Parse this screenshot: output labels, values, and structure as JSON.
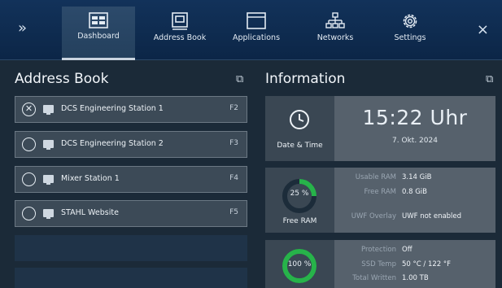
{
  "nav": {
    "expand_glyph": "»",
    "close_glyph": "×",
    "tabs": [
      {
        "label": "Dashboard",
        "icon": "dashboard-icon",
        "active": true
      },
      {
        "label": "Address Book",
        "icon": "address-book-icon",
        "active": false
      },
      {
        "label": "Applications",
        "icon": "applications-icon",
        "active": false
      },
      {
        "label": "Networks",
        "icon": "networks-icon",
        "active": false
      },
      {
        "label": "Settings",
        "icon": "settings-icon",
        "active": false
      }
    ]
  },
  "address_book": {
    "title": "Address Book",
    "items": [
      {
        "name": "DCS Engineering Station 1",
        "key": "F2",
        "selected": true
      },
      {
        "name": "DCS Engineering Station 2",
        "key": "F3",
        "selected": false
      },
      {
        "name": "Mixer Station 1",
        "key": "F4",
        "selected": false
      },
      {
        "name": "STAHL Website",
        "key": "F5",
        "selected": false
      }
    ]
  },
  "information": {
    "title": "Information",
    "datetime": {
      "caption": "Date & Time",
      "time": "15:22 Uhr",
      "date": "7. Okt. 2024"
    },
    "ram": {
      "caption": "Free RAM",
      "percent_label": "25 %",
      "percent_value": 25,
      "usable_label": "Usable RAM",
      "usable_value": "3.14 GiB",
      "free_label": "Free RAM",
      "free_value": "0.8 GiB",
      "overlay_label": "UWF Overlay",
      "overlay_value": "UWF not enabled"
    },
    "ssd": {
      "percent_label": "100 %",
      "percent_value": 100,
      "protection_label": "Protection",
      "protection_value": "Off",
      "temp_label": "SSD Temp",
      "temp_value": "50 °C / 122 °F",
      "written_label": "Total Written",
      "written_value": "1.00 TB"
    }
  },
  "colors": {
    "accent_green": "#27b34a",
    "ring_track": "#1c2c3a"
  }
}
